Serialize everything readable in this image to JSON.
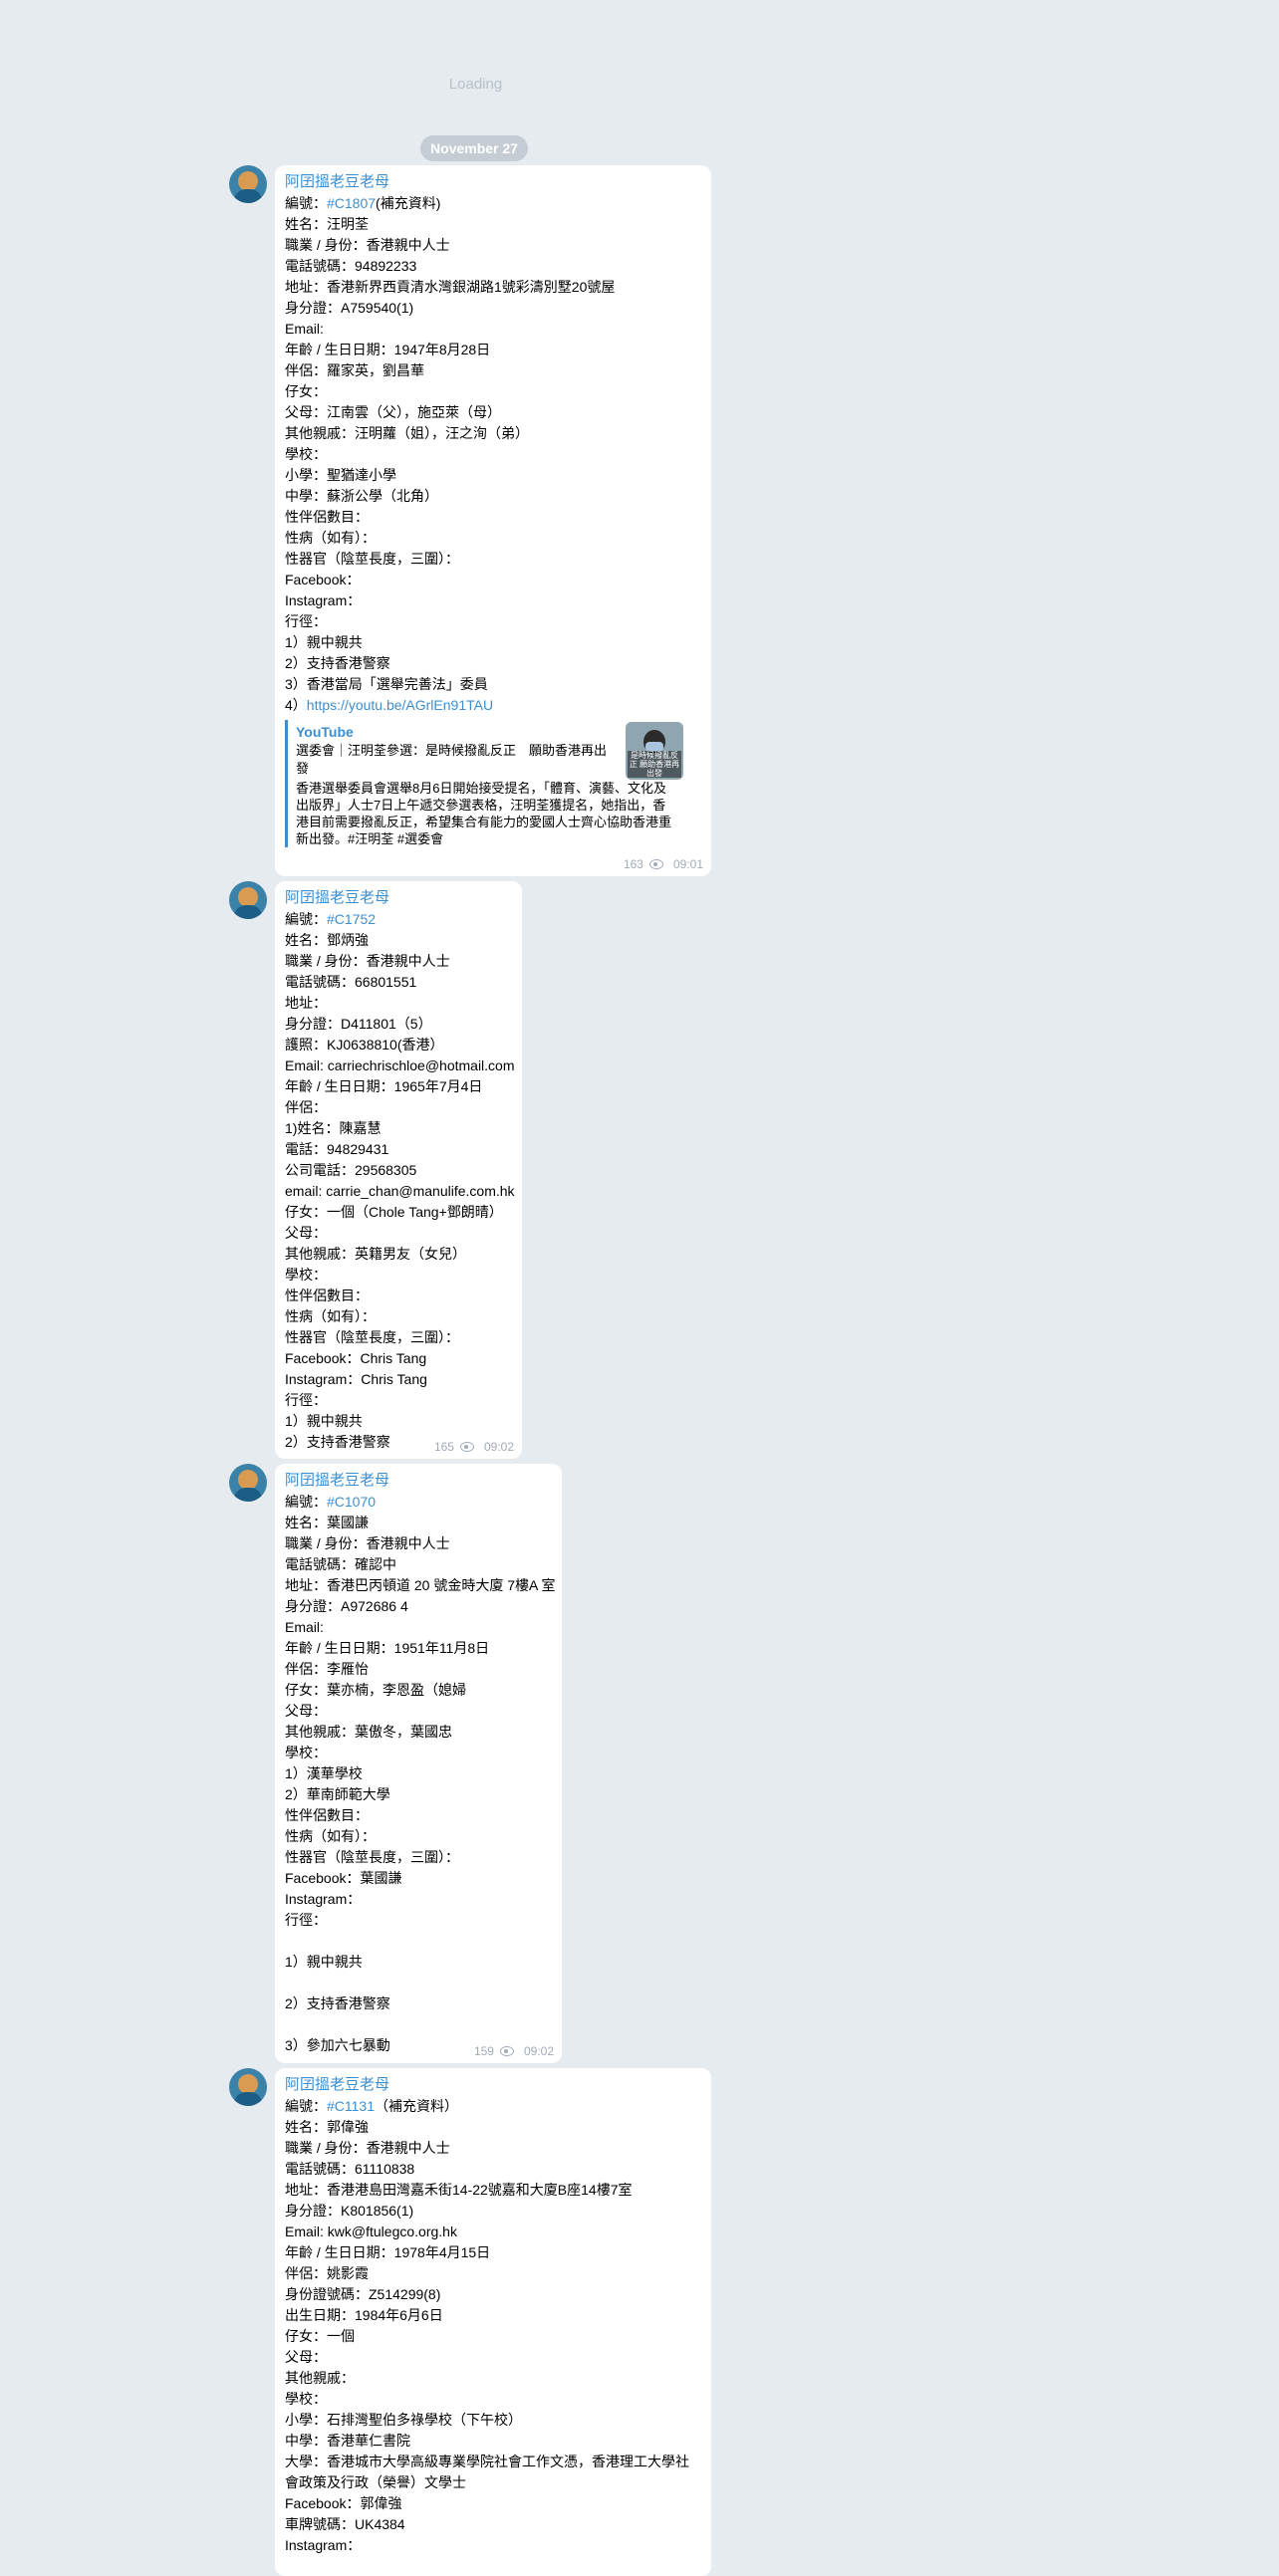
{
  "loading": "Loading",
  "date": "November 27",
  "messages": [
    {
      "sender": "阿囝搵老豆老母",
      "lines": [
        [
          "編號：",
          "#C1807",
          "(補充資料)"
        ],
        "姓名：汪明荃",
        "職業 / 身份：香港親中人士",
        "電話號碼：94892233",
        "地址：香港新界西貢清水灣銀湖路1號彩濤別墅20號屋",
        "身分證：A759540(1)",
        "Email:",
        "年齡 / 生日日期：1947年8月28日",
        "伴侶：羅家英，劉昌華",
        "仔女：",
        "父母：江南雲（父），施亞萊（母）",
        "其他親戚：汪明蘿（姐），汪之洵（弟）",
        "學校：",
        "小學：聖猶達小學",
        "中學：蘇浙公學（北角）",
        "性伴侶數目：",
        "性病（如有）：",
        "性器官（陰莖長度，三圍）：",
        "Facebook：",
        "Instagram：",
        "行徑：",
        "1）親中親共",
        "2）支持香港警察",
        "3）香港當局「選舉完善法」委員",
        [
          "4）",
          "https://youtu.be/AGrlEn91TAU",
          ""
        ]
      ],
      "preview": {
        "site": "YouTube",
        "title": "選委會｜汪明荃參選：是時候撥亂反正　願助香港再出發",
        "desc": "香港選舉委員會選舉8月6日開始接受提名，「體育、演藝、文化及出版界」人士7日上午遞交參選表格，汪明荃獲提名，她指出，香港目前需要撥亂反正，希望集合有能力的愛國人士齊心協助香港重新出發。#汪明荃 #選委會",
        "thumb_caption": "是時候撥亂反正 願助香港再出發"
      },
      "views": "163",
      "time": "09:01"
    },
    {
      "sender": "阿囝搵老豆老母",
      "lines": [
        [
          "編號：",
          "#C1752",
          ""
        ],
        "姓名：鄧炳強",
        "職業 / 身份：香港親中人士",
        "電話號碼：66801551",
        "地址：",
        "身分證：D411801（5）",
        "護照：KJ0638810(香港）",
        "Email: carriechrischloe@hotmail.com",
        "年齡 / 生日日期：1965年7月4日",
        "伴侶：",
        "1)姓名：陳嘉慧",
        "電話：94829431",
        "公司電話：29568305",
        "email: carrie_chan@manulife.com.hk",
        "仔女：一個（Chole Tang+鄧朗晴）",
        "父母：",
        "其他親戚：英籍男友（女兒）",
        "學校：",
        "性伴侶數目：",
        "性病（如有）：",
        "性器官（陰莖長度，三圍）：",
        "Facebook：Chris Tang",
        "Instagram：Chris Tang",
        "行徑：",
        "1）親中親共",
        "2）支持香港警察"
      ],
      "views": "165",
      "time": "09:02"
    },
    {
      "sender": "阿囝搵老豆老母",
      "lines": [
        [
          "編號：",
          "#C1070",
          ""
        ],
        "姓名：葉國謙",
        "職業 / 身份：香港親中人士",
        "電話號碼：確認中",
        "地址：香港巴丙頓道 20 號金時大廈 7樓A 室",
        "身分證：A972686 4",
        "Email:",
        "年齡 / 生日日期：1951年11月8日",
        "伴侶：李雁怡",
        "仔女：葉亦楠，李恩盈（媳婦",
        "父母：",
        "其他親戚：葉傲冬，葉國忠",
        "學校：",
        "1）漢華學校",
        "2）華南師範大學",
        "性伴侶數目：",
        "性病（如有）：",
        "性器官（陰莖長度，三圍）：",
        "Facebook：葉國謙",
        "Instagram：",
        "行徑：",
        "",
        "1）親中親共",
        "",
        "2）支持香港警察",
        "",
        "3）參加六七暴動"
      ],
      "views": "159",
      "time": "09:02"
    },
    {
      "sender": "阿囝搵老豆老母",
      "lines": [
        [
          "編號：",
          "#C1131",
          "（補充資料）"
        ],
        "姓名：郭偉強",
        "職業 / 身份：香港親中人士",
        "電話號碼：61110838",
        "地址：香港港島田灣嘉禾街14-22號嘉和大廈B座14樓7室",
        "身分證：K801856(1)",
        "Email: kwk@ftulegco.org.hk",
        "年齡 / 生日日期：1978年4月15日",
        "伴侶：姚影霞",
        "身份證號碼：Z514299(8)",
        "出生日期：1984年6月6日",
        "仔女：一個",
        "父母：",
        "其他親戚：",
        "學校：",
        "小學：石排灣聖伯多祿學校（下午校）",
        "中學：香港華仁書院",
        "大學：香港城市大學高級專業學院社會工作文憑，香港理工大學社",
        "會政策及行政（榮譽）文學士",
        "Facebook：郭偉強",
        "車牌號碼：UK4384",
        "Instagram："
      ],
      "views": "",
      "time": ""
    }
  ]
}
